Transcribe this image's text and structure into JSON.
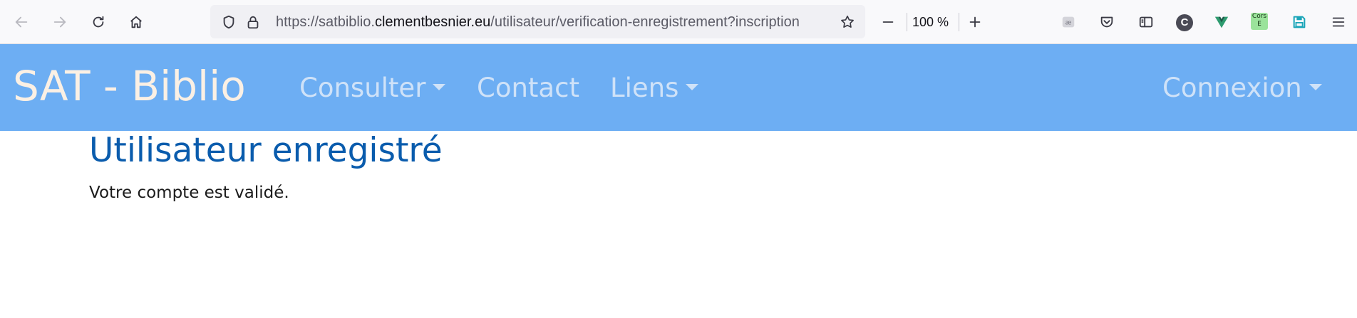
{
  "browser": {
    "url_prefix": "https://satbiblio.",
    "url_host": "clementbesnier.eu",
    "url_path": "/utilisateur/verification-enregistrement?inscription",
    "zoom_level": "100 %",
    "extensions": {
      "cors_label_top": "Cors",
      "cors_label_bottom": "E",
      "c_ext_label": "C"
    },
    "icons": {
      "back": "arrow-left-icon",
      "forward": "arrow-right-icon",
      "reload": "reload-icon",
      "home": "home-icon",
      "shield": "shield-icon",
      "lock": "lock-icon",
      "bookmark": "star-icon",
      "zoom_out": "minus-icon",
      "zoom_in": "plus-icon",
      "reader": "reader-view-icon",
      "pocket": "pocket-icon",
      "sidebar": "sidebar-icon",
      "vue": "vue-devtools-icon",
      "save": "floppy-icon",
      "menu": "hamburger-menu-icon"
    }
  },
  "navbar": {
    "brand": "SAT - Biblio",
    "items": [
      {
        "label": "Consulter",
        "dropdown": true
      },
      {
        "label": "Contact",
        "dropdown": false
      },
      {
        "label": "Liens",
        "dropdown": true
      }
    ],
    "login": {
      "label": "Connexion",
      "dropdown": true
    },
    "background_color": "#6daef3"
  },
  "main": {
    "title": "Utilisateur enregistré",
    "message": "Votre compte est validé.",
    "title_color": "#0a5cad"
  }
}
